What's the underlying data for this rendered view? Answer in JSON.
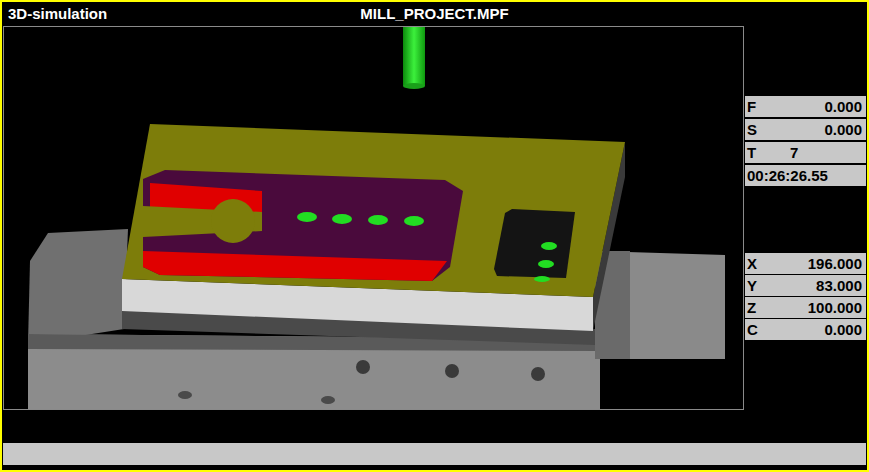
{
  "window": {
    "title": "3D-simulation",
    "program": "MILL_PROJECT.MPF"
  },
  "status": [
    {
      "label": "F",
      "value": "0.000",
      "kind": "number"
    },
    {
      "label": "S",
      "value": "0.000",
      "kind": "number"
    },
    {
      "label": "T",
      "value": "7",
      "kind": "tool"
    }
  ],
  "time": "00:26:26.55",
  "axes": [
    {
      "label": "X",
      "value": "196.000"
    },
    {
      "label": "Y",
      "value": "83.000"
    },
    {
      "label": "Z",
      "value": "100.000"
    },
    {
      "label": "C",
      "value": "0.000"
    }
  ]
}
